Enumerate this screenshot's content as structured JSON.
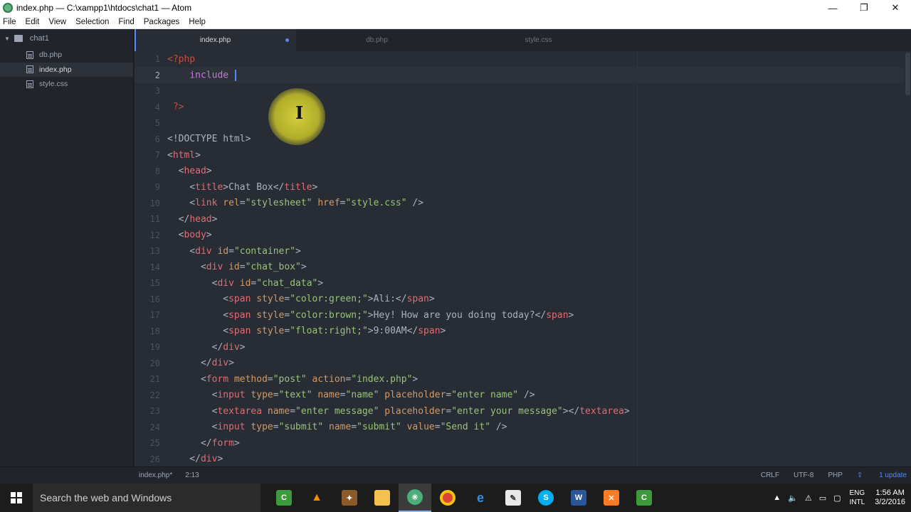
{
  "window": {
    "title": "index.php — C:\\xampp1\\htdocs\\chat1 — Atom",
    "minimize": "—",
    "maximize": "❐",
    "close": "✕"
  },
  "menu": [
    "File",
    "Edit",
    "View",
    "Selection",
    "Find",
    "Packages",
    "Help"
  ],
  "tree": {
    "root": "chat1",
    "files": [
      "db.php",
      "index.php",
      "style.css"
    ]
  },
  "tabs": [
    "index.php",
    "db.php",
    "style.css"
  ],
  "editor": {
    "line_numbers": [
      "1",
      "2",
      "3",
      "4",
      "5",
      "6",
      "7",
      "8",
      "9",
      "10",
      "11",
      "12",
      "13",
      "14",
      "15",
      "16",
      "17",
      "18",
      "19",
      "20",
      "21",
      "22",
      "23",
      "24",
      "25",
      "26"
    ]
  },
  "status": {
    "file": "index.php*",
    "cursor": "2:13",
    "line_ending": "CRLF",
    "encoding": "UTF-8",
    "grammar": "PHP",
    "updates": "1 update"
  },
  "taskbar": {
    "search_placeholder": "Search the web and Windows",
    "lang_top": "ENG",
    "lang_bottom": "INTL",
    "time": "1:56 AM",
    "date": "3/2/2016"
  },
  "colors": {
    "editor_bg": "#282c34",
    "accent": "#568af2",
    "tag": "#e06c75",
    "attr": "#d19a66",
    "string": "#98c379",
    "keyword": "#c678dd"
  }
}
